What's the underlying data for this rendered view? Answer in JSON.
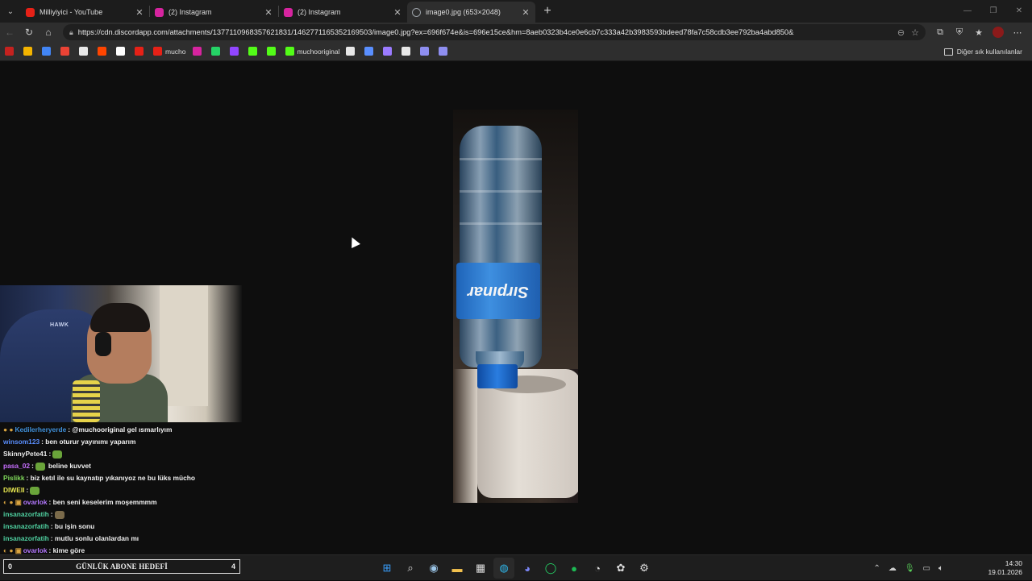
{
  "browser": {
    "tabs": [
      {
        "title": "Milliyiyici - YouTube",
        "color": "#e62117"
      },
      {
        "title": "(2) Instagram",
        "color": "#d6249f"
      },
      {
        "title": "(2) Instagram",
        "color": "#d6249f"
      },
      {
        "title": "image0.jpg (653×2048)",
        "color": "#9aa0a6"
      }
    ],
    "url": "https://cdn.discordapp.com/attachments/1377110968357621831/1462771165352169503/image0.jpg?ex=696f674e&is=696e15ce&hm=8aeb0323b4ce0e6cb7c333a42b3983593bdeed78fa7c58cdb3ee792ba4abd850&",
    "bookmarks": [
      {
        "label": "",
        "icon": "gmail-icon"
      },
      {
        "label": "",
        "icon": "photos-icon"
      },
      {
        "label": "",
        "icon": "translate-icon"
      },
      {
        "label": "",
        "icon": "mail-icon"
      },
      {
        "label": "",
        "icon": "chrome-icon"
      },
      {
        "label": "",
        "icon": "reddit-icon"
      },
      {
        "label": "",
        "icon": "x-icon"
      },
      {
        "label": "",
        "icon": "youtube-icon"
      },
      {
        "label": "mucho",
        "icon": "youtube-icon"
      },
      {
        "label": "",
        "icon": "instagram-icon"
      },
      {
        "label": "",
        "icon": "whatsapp-icon"
      },
      {
        "label": "",
        "icon": "twitch-icon"
      },
      {
        "label": "",
        "icon": "kick-icon"
      },
      {
        "label": "",
        "icon": "kick-icon"
      },
      {
        "label": "muchooriginal",
        "icon": "kick-icon"
      },
      {
        "label": "",
        "icon": "openai-icon"
      },
      {
        "label": "",
        "icon": "link-icon"
      },
      {
        "label": "",
        "icon": "feather-icon"
      },
      {
        "label": "",
        "icon": "tm-icon"
      },
      {
        "label": "",
        "icon": "shield-icon"
      },
      {
        "label": "",
        "icon": "shield-icon"
      }
    ],
    "other_bookmarks": "Diğer sık kullanılanlar"
  },
  "photo": {
    "label_text": "Sırpınar"
  },
  "webcam": {
    "chair_brand": "HAWK"
  },
  "chat": [
    {
      "user": "Kedilerheryerde",
      "color": "#3f8fd8",
      "badges": "● ●",
      "text": ": @muchooriginal gel ısmarlıyım",
      "emote": ""
    },
    {
      "user": "winsom123",
      "color": "#5a8fff",
      "badges": "",
      "text": ": ben oturur yayınımı yaparım",
      "emote": ""
    },
    {
      "user": "SkinnyPete41",
      "color": "#e8e8e8",
      "badges": "",
      "text": ":",
      "emote": "green"
    },
    {
      "user": "pasa_02",
      "color": "#c86fff",
      "badges": "",
      "text": ":",
      "emote": "green",
      "text2": "beline kuvvet"
    },
    {
      "user": "Pislikk",
      "color": "#7fd85a",
      "badges": "",
      "text": ": biz ketıl ile su kaynatıp yıkanıyoz ne bu lüks mücho",
      "emote": ""
    },
    {
      "user": "DIWEII",
      "color": "#e8e850",
      "badges": "",
      "text": ":",
      "emote": "green"
    },
    {
      "user": "ovarlok",
      "color": "#b478ff",
      "badges": "◐ ● ▣",
      "text": ": ben seni keselerim moşemmmm",
      "emote": ""
    },
    {
      "user": "insanazorfatih",
      "color": "#4fd0a0",
      "badges": "",
      "text": ":",
      "emote": "brown"
    },
    {
      "user": "insanazorfatih",
      "color": "#4fd0a0",
      "badges": "",
      "text": ": bu işin sonu",
      "emote": ""
    },
    {
      "user": "insanazorfatih",
      "color": "#4fd0a0",
      "badges": "",
      "text": ": mutlu sonlu olanlardan mı",
      "emote": ""
    },
    {
      "user": "ovarlok",
      "color": "#b478ff",
      "badges": "◐ ● ▣",
      "text": ": kime göre",
      "emote": ""
    }
  ],
  "goal": {
    "current": "0",
    "title": "GÜNLÜK ABONE HEDEFİ",
    "target": "4"
  },
  "taskbar": {
    "time": "14:30",
    "date": "19.01.2026"
  }
}
